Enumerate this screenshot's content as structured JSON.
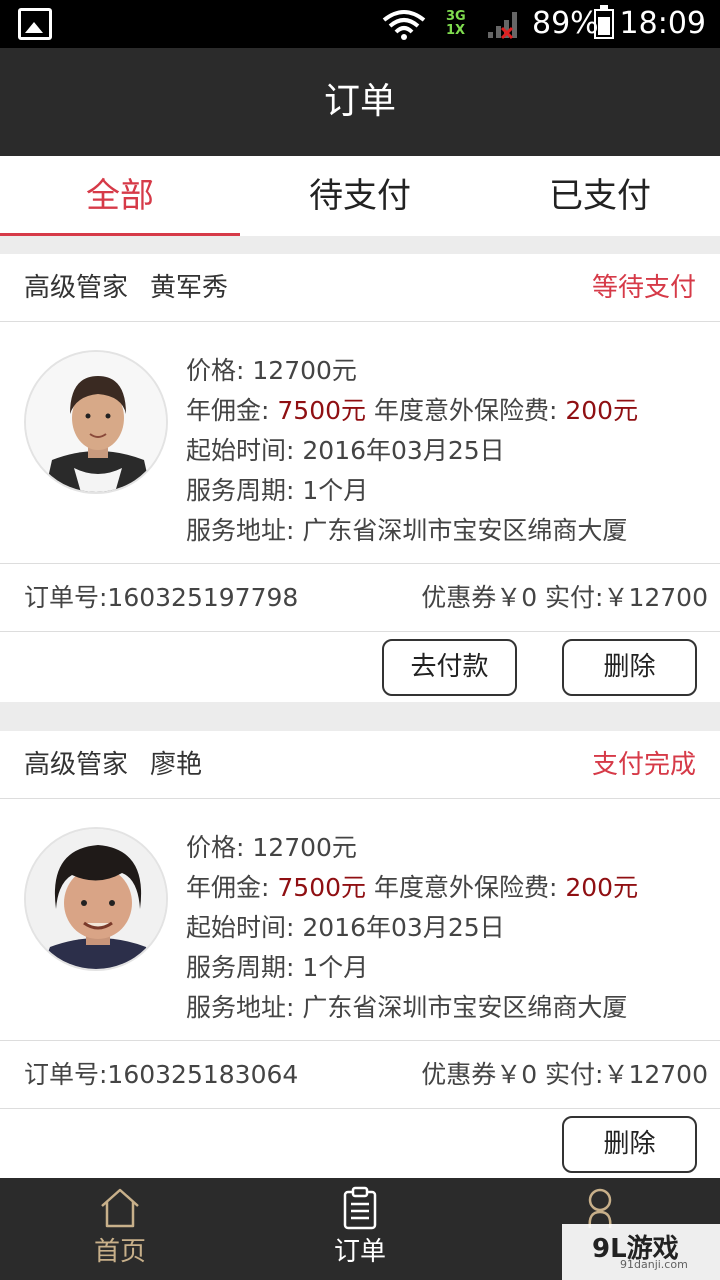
{
  "status_bar": {
    "network": "3G\n1X",
    "battery": "89%",
    "time": "18:09"
  },
  "app_bar": {
    "title": "订单"
  },
  "tabs": [
    {
      "label": "全部",
      "active": true
    },
    {
      "label": "待支付",
      "active": false
    },
    {
      "label": "已支付",
      "active": false
    }
  ],
  "orders": [
    {
      "role": "高级管家",
      "name": "黄军秀",
      "status": "等待支付",
      "price_label": "价格:",
      "price": "12700元",
      "commission_label": "年佣金:",
      "commission": "7500元",
      "insurance_label": "年度意外保险费:",
      "insurance": "200元",
      "start_label": "起始时间:",
      "start": "2016年03月25日",
      "period_label": "服务周期:",
      "period": "1个月",
      "address_label": "服务地址:",
      "address": "广东省深圳市宝安区绵商大厦",
      "order_no": "订单号:160325197798",
      "payment": "优惠券￥0 实付:￥12700",
      "pay_button": "去付款",
      "delete_button": "删除"
    },
    {
      "role": "高级管家",
      "name": "廖艳",
      "status": "支付完成",
      "price_label": "价格:",
      "price": "12700元",
      "commission_label": "年佣金:",
      "commission": "7500元",
      "insurance_label": "年度意外保险费:",
      "insurance": "200元",
      "start_label": "起始时间:",
      "start": "2016年03月25日",
      "period_label": "服务周期:",
      "period": "1个月",
      "address_label": "服务地址:",
      "address": "广东省深圳市宝安区绵商大厦",
      "order_no": "订单号:160325183064",
      "payment": "优惠券￥0 实付:￥12700",
      "delete_button": "删除"
    }
  ],
  "bottom_nav": [
    {
      "label": "首页",
      "icon": "home-icon",
      "active": false
    },
    {
      "label": "订单",
      "icon": "clipboard-icon",
      "active": true
    },
    {
      "label": "",
      "icon": "user-icon",
      "active": false
    }
  ],
  "watermark": {
    "text": "9L游戏",
    "sub": "91danji.com"
  },
  "colors": {
    "accent": "#d63a48",
    "dark_bar": "#2b2b2b",
    "amount": "#8f0f12",
    "nav_inactive": "#c8b08a"
  }
}
